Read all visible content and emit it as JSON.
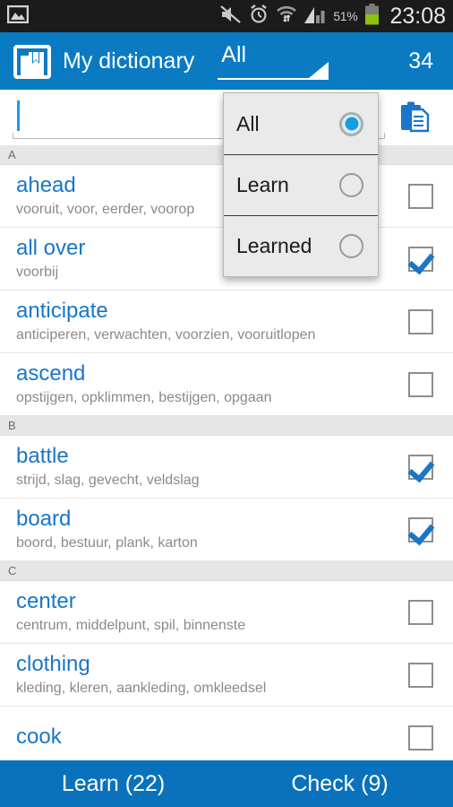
{
  "statusbar": {
    "time": "23:08",
    "battery_percent": "51%",
    "icons": [
      "image-icon",
      "mute-icon",
      "alarm-icon",
      "wifi-icon",
      "signal-icon",
      "battery-icon"
    ]
  },
  "actionbar": {
    "app_icon": "book-bookmark-icon",
    "title": "My dictionary",
    "filter_label": "All",
    "count": "34"
  },
  "search": {
    "value": "",
    "placeholder": "",
    "paste_icon": "clipboard-paste-icon"
  },
  "dropdown": {
    "open": true,
    "items": [
      {
        "label": "All",
        "selected": true
      },
      {
        "label": "Learn",
        "selected": false
      },
      {
        "label": "Learned",
        "selected": false
      }
    ]
  },
  "list": [
    {
      "type": "header",
      "label": "A"
    },
    {
      "type": "row",
      "word": "ahead",
      "translation": "vooruit, voor, eerder, voorop",
      "checked": false
    },
    {
      "type": "row",
      "word": "all over",
      "translation": "voorbij",
      "checked": true
    },
    {
      "type": "row",
      "word": "anticipate",
      "translation": "anticiperen, verwachten, voorzien, vooruitlopen",
      "checked": false
    },
    {
      "type": "row",
      "word": "ascend",
      "translation": "opstijgen, opklimmen, bestijgen, opgaan",
      "checked": false
    },
    {
      "type": "header",
      "label": "B"
    },
    {
      "type": "row",
      "word": "battle",
      "translation": "strijd, slag, gevecht, veldslag",
      "checked": true
    },
    {
      "type": "row",
      "word": "board",
      "translation": "boord, bestuur, plank, karton",
      "checked": true
    },
    {
      "type": "header",
      "label": "C"
    },
    {
      "type": "row",
      "word": "center",
      "translation": "centrum, middelpunt, spil, binnenste",
      "checked": false
    },
    {
      "type": "row",
      "word": "clothing",
      "translation": "kleding, kleren, aankleding, omkleedsel",
      "checked": false
    },
    {
      "type": "row",
      "word": "cook",
      "translation": "",
      "checked": false
    }
  ],
  "bottombar": {
    "learn_label": "Learn (22)",
    "check_label": "Check (9)"
  },
  "colors": {
    "accent": "#0a7bc2",
    "bottom_bar": "#0a72bc",
    "word": "#1976c8",
    "translation": "#8a8a8a",
    "section_bg": "#e6e6e6",
    "statusbar_bg": "#1b1b1b"
  }
}
